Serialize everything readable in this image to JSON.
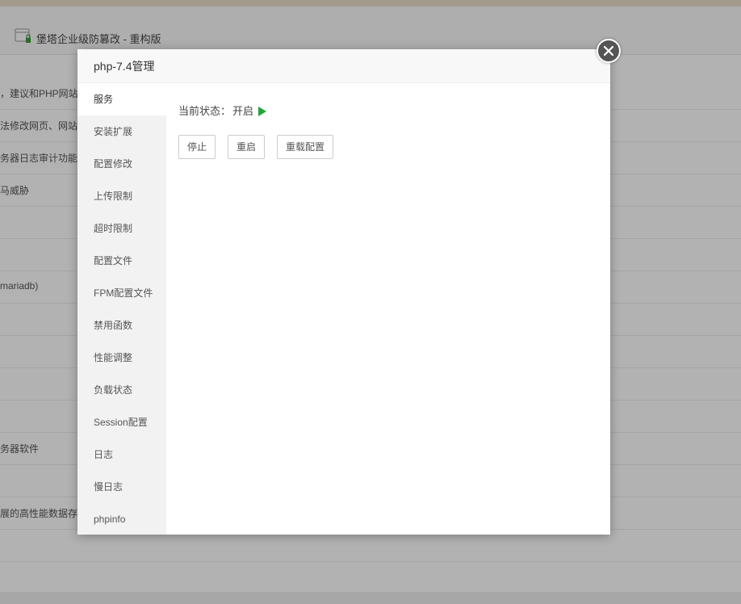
{
  "background": {
    "app_title": "堡塔企业级防篡改 - 重构版",
    "rows": [
      "，建议和PHP网站",
      "法修改网页、网站",
      "务器日志审计功能",
      "马威胁",
      "",
      "",
      "mariadb)",
      "",
      "",
      "",
      "",
      "务器软件",
      "",
      "展的高性能数据存",
      ""
    ]
  },
  "dialog": {
    "title": "php-7.4管理",
    "nav": [
      {
        "label": "服务",
        "active": true
      },
      {
        "label": "安装扩展"
      },
      {
        "label": "配置修改"
      },
      {
        "label": "上传限制"
      },
      {
        "label": "超时限制"
      },
      {
        "label": "配置文件"
      },
      {
        "label": "FPM配置文件"
      },
      {
        "label": "禁用函数"
      },
      {
        "label": "性能调整"
      },
      {
        "label": "负载状态"
      },
      {
        "label": "Session配置"
      },
      {
        "label": "日志"
      },
      {
        "label": "慢日志"
      },
      {
        "label": "phpinfo"
      }
    ],
    "status_label": "当前状态：",
    "status_value": "开启",
    "buttons": {
      "stop": "停止",
      "restart": "重启",
      "reload": "重载配置"
    },
    "status_color": "#20a53a"
  }
}
